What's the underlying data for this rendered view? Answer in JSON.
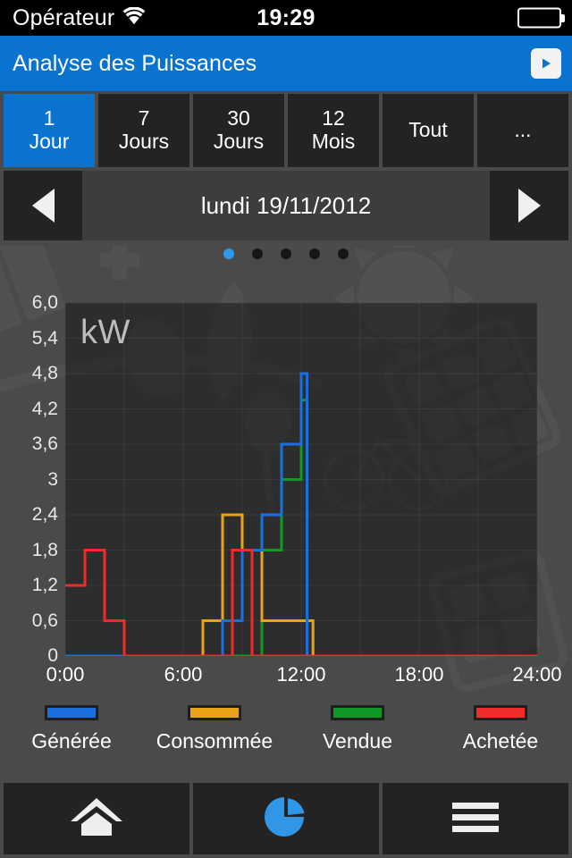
{
  "statusbar": {
    "carrier": "Opérateur",
    "wifi_icon": "wifi-icon",
    "time": "19:29",
    "battery_icon": "battery-full-icon"
  },
  "header": {
    "title": "Analyse des Puissances",
    "play_icon": "play-icon"
  },
  "range_tabs": [
    {
      "line1": "1",
      "line2": "Jour",
      "active": true
    },
    {
      "line1": "7",
      "line2": "Jours",
      "active": false
    },
    {
      "line1": "30",
      "line2": "Jours",
      "active": false
    },
    {
      "line1": "12",
      "line2": "Mois",
      "active": false
    },
    {
      "line1": "",
      "line2": "Tout",
      "active": false
    },
    {
      "line1": "",
      "line2": "...",
      "active": false
    }
  ],
  "date_nav": {
    "prev_icon": "chevron-left-icon",
    "label": "lundi 19/11/2012",
    "next_icon": "chevron-right-icon"
  },
  "page_dots": {
    "count": 5,
    "active_index": 0,
    "active_color": "#2f96e8",
    "inactive_color": "#161616"
  },
  "legend": [
    {
      "label": "Générée",
      "color": "#1b6fe0"
    },
    {
      "label": "Consommée",
      "color": "#e8a317"
    },
    {
      "label": "Vendue",
      "color": "#0f9a27"
    },
    {
      "label": "Achetée",
      "color": "#ef2b2b"
    }
  ],
  "tabbar": [
    {
      "icon": "home-icon",
      "active": false
    },
    {
      "icon": "pie-chart-icon",
      "active": true
    },
    {
      "icon": "menu-icon",
      "active": false
    }
  ],
  "chart_data": {
    "type": "line",
    "title": "",
    "unit_label": "kW",
    "xlabel": "",
    "ylabel": "kW",
    "grid": true,
    "legend_position": "bottom",
    "ylim": [
      0,
      6
    ],
    "yticks": [
      0,
      0.6,
      1.2,
      1.8,
      2.4,
      3,
      3.6,
      4.2,
      4.8,
      5.4,
      6
    ],
    "ytick_labels": [
      "0",
      "0,6",
      "1,2",
      "1,8",
      "2,4",
      "3",
      "3,6",
      "4,2",
      "4,8",
      "5,4",
      "6,0"
    ],
    "xlim": [
      0,
      24
    ],
    "xticks": [
      0,
      6,
      12,
      18,
      24
    ],
    "xtick_labels": [
      "0:00",
      "6:00",
      "12:00",
      "18:00",
      "24:00"
    ],
    "x": [
      0,
      0.5,
      1,
      1.5,
      2,
      2.5,
      3,
      3.5,
      4,
      5,
      6,
      6.5,
      7,
      7.5,
      8,
      8.5,
      9,
      9.5,
      10,
      10.5,
      11,
      11.5,
      12,
      12.3,
      12.6,
      13,
      13.3,
      14,
      18,
      24
    ],
    "series": [
      {
        "name": "Générée",
        "color": "#1b6fe0",
        "values": [
          0,
          0,
          0,
          0,
          0,
          0,
          0,
          0,
          0,
          0,
          0,
          0,
          0,
          0,
          0.6,
          0.6,
          1.8,
          1.8,
          2.4,
          2.4,
          3.6,
          3.6,
          4.8,
          0,
          0,
          0,
          0,
          0,
          0,
          0
        ]
      },
      {
        "name": "Consommée",
        "color": "#e8a317",
        "values": [
          0,
          0,
          0,
          0,
          0,
          0,
          0,
          0,
          0,
          0,
          0,
          0,
          0.6,
          0.6,
          2.4,
          2.4,
          1.8,
          1.8,
          0.6,
          0.6,
          0.6,
          0.6,
          0.6,
          0.6,
          0,
          0,
          0,
          0,
          0,
          0
        ]
      },
      {
        "name": "Vendue",
        "color": "#0f9a27",
        "values": [
          0,
          0,
          0,
          0,
          0,
          0,
          0,
          0,
          0,
          0,
          0,
          0,
          0,
          0,
          0,
          0,
          0,
          0,
          1.8,
          1.8,
          3.0,
          3.0,
          4.35,
          0,
          0,
          0,
          0,
          0,
          0,
          0
        ]
      },
      {
        "name": "Achetée",
        "color": "#ef2b2b",
        "values": [
          1.2,
          1.2,
          1.8,
          1.8,
          0.6,
          0.6,
          0,
          0,
          0,
          0,
          0,
          0,
          0,
          0,
          0,
          1.8,
          1.8,
          0,
          0,
          0,
          0,
          0,
          0,
          0,
          0,
          0,
          0,
          0,
          0,
          0
        ]
      }
    ]
  }
}
